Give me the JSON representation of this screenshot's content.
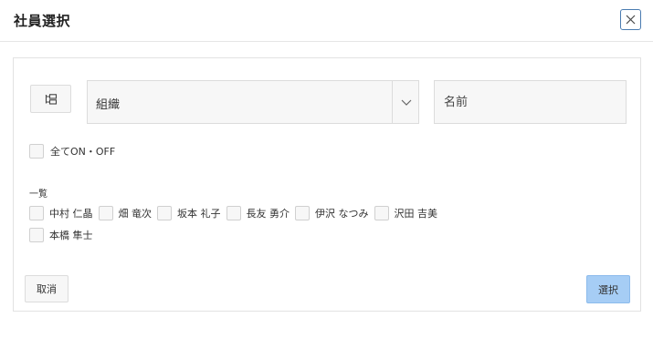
{
  "dialog": {
    "title": "社員選択",
    "close_icon": "close-icon"
  },
  "filters": {
    "org_button_icon": "org-chart-icon",
    "org_select": {
      "value": "組織",
      "chevron_icon": "chevron-down-icon"
    },
    "name_field": {
      "placeholder": "名前",
      "value": ""
    }
  },
  "toggle_all": {
    "label": "全てON・OFF",
    "checked": false
  },
  "employee_list": {
    "label": "一覧",
    "rows": [
      [
        {
          "name": "中村 仁晶",
          "checked": false
        },
        {
          "name": "畑 竜次",
          "checked": false
        },
        {
          "name": "坂本 礼子",
          "checked": false
        },
        {
          "name": "長友 勇介",
          "checked": false
        },
        {
          "name": "伊沢 なつみ",
          "checked": false
        },
        {
          "name": "沢田 吉美",
          "checked": false
        }
      ],
      [
        {
          "name": "本橋 隼士",
          "checked": false
        }
      ]
    ]
  },
  "footer": {
    "cancel_label": "取消",
    "select_label": "選択"
  },
  "colors": {
    "accent_border": "#4a7bb0",
    "primary_button": "#a6cdf5",
    "field_background": "#f7f7f7",
    "border": "#dcdcdc"
  }
}
